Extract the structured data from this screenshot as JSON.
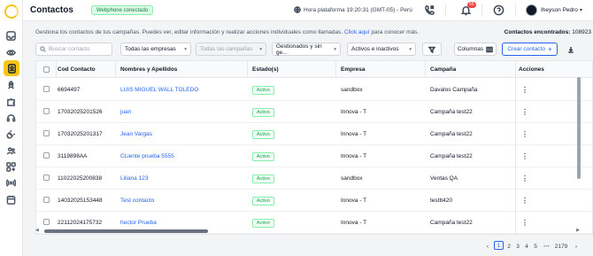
{
  "header": {
    "title": "Contactos",
    "status_badge": "Webphone conectado",
    "clock_text": "Hora plataforma 19:20:31 (GMT-05) - Perú",
    "notification_count": "55",
    "user_name": "Iheyson Pedro"
  },
  "description": {
    "text": "Gestiona los contactos de tus campañas. Puedes ver, editar información y realizar acciones individuales como llamadas.",
    "link": "Click aquí",
    "link_suffix": "para conocer más."
  },
  "found": {
    "label": "Contactos encontrados:",
    "value": "108923"
  },
  "filters": {
    "search_placeholder": "Buscar contacto",
    "company": "Todas las empresas",
    "campaign": "Todas las campañas",
    "managed": "Gestionados y sin ge...",
    "active": "Activos e inactivos",
    "columns_label": "Columnas",
    "create_label": "Crear contacto"
  },
  "table": {
    "headers": [
      "Cod Contacto",
      "Nombres y Apellidos",
      "Estado(s)",
      "Empresa",
      "Campaña",
      "Acciones"
    ],
    "rows": [
      {
        "code": "6694497",
        "name": "LUIS MIGUEL WALL TOLEDO",
        "status": "Activo",
        "company": "sandbox",
        "campaign": "Davalos Campaña"
      },
      {
        "code": "17032025201526",
        "name": "juan",
        "status": "Activo",
        "company": "Innova - T",
        "campaign": "Campaña test22"
      },
      {
        "code": "17032025201317",
        "name": "Jean Vargas",
        "status": "Activo",
        "company": "Innova - T",
        "campaign": "Campaña test22"
      },
      {
        "code": "3119898AA",
        "name": "CLiente prueba 5555",
        "status": "Activo",
        "company": "Innova - T",
        "campaign": "Campaña test22"
      },
      {
        "code": "11022025200838",
        "name": "Liliana 123",
        "status": "Activo",
        "company": "sandbox",
        "campaign": "Ventas QA"
      },
      {
        "code": "14032025153448",
        "name": "Test contacto",
        "status": "Activo",
        "company": "Innova - T",
        "campaign": "testtt420"
      },
      {
        "code": "22112024175732",
        "name": "hector Prueba",
        "status": "Activo",
        "company": "Innova - T",
        "campaign": "Campaña test22"
      }
    ]
  },
  "pagination": {
    "pages": [
      "1",
      "2",
      "3",
      "4",
      "5",
      "•••",
      "2179"
    ],
    "current": "1"
  },
  "colors": {
    "accent": "#f5c518",
    "link": "#2563eb",
    "active_badge": "#16a34a",
    "notification": "#ef4444"
  },
  "icons": {
    "sidebar": [
      "logo",
      "inbox-icon",
      "eye-icon",
      "contacts-icon",
      "rocket-icon",
      "puzzle-icon",
      "headset-icon",
      "plug-icon",
      "people-icon",
      "grid-plus-icon",
      "broadcast-icon",
      "calendar-icon"
    ]
  }
}
